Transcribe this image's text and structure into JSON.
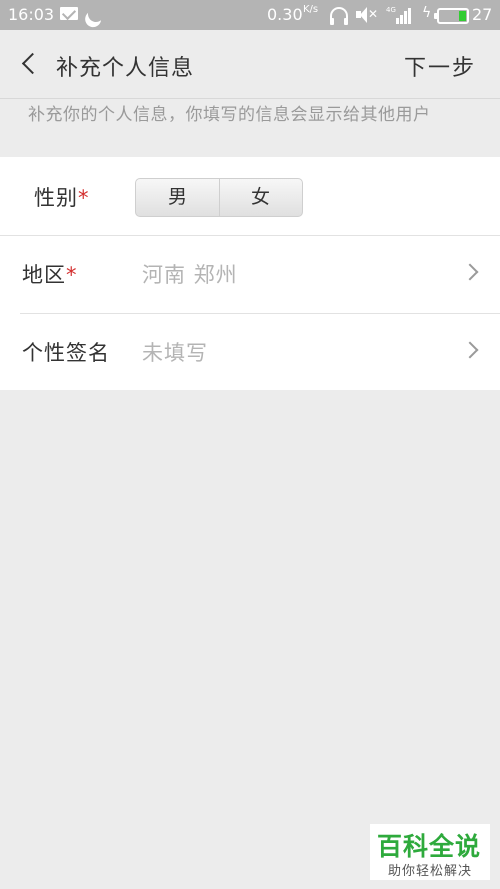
{
  "status_bar": {
    "time": "16:03",
    "speed": "0.30",
    "speed_unit": "K/s",
    "network": "4G",
    "battery_level": "27",
    "battery_percent": 27,
    "battery_color": "#33cc33",
    "icons": [
      "mail-icon",
      "moon-icon",
      "headset-icon",
      "mute-icon",
      "signal-icon",
      "charge-icon",
      "battery-icon"
    ]
  },
  "header": {
    "title": "补充个人信息",
    "next_label": "下一步"
  },
  "hint": "补充你的个人信息，你填写的信息会显示给其他用户",
  "form": {
    "gender": {
      "label": "性别",
      "required_mark": "*",
      "options": [
        "男",
        "女"
      ]
    },
    "region": {
      "label": "地区",
      "required_mark": "*",
      "value": "河南 郑州"
    },
    "signature": {
      "label": "个性签名",
      "placeholder": "未填写"
    }
  },
  "watermark": {
    "title": "百科全说",
    "subtitle": "助你轻松解决"
  },
  "colors": {
    "background": "#ececec",
    "required": "#d32f2f",
    "watermark": "#2eaa3c"
  }
}
